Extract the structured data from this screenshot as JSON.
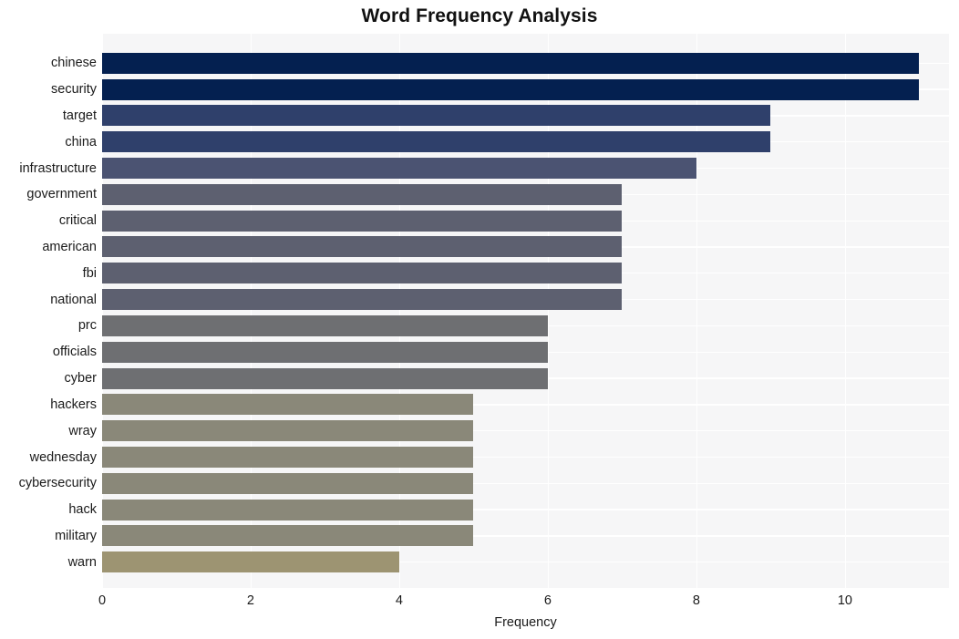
{
  "chart_data": {
    "type": "bar",
    "orientation": "horizontal",
    "title": "Word Frequency Analysis",
    "xlabel": "Frequency",
    "ylabel": "",
    "categories": [
      "chinese",
      "security",
      "target",
      "china",
      "infrastructure",
      "government",
      "critical",
      "american",
      "fbi",
      "national",
      "prc",
      "officials",
      "cyber",
      "hackers",
      "wray",
      "wednesday",
      "cybersecurity",
      "hack",
      "military",
      "warn"
    ],
    "values": [
      11,
      11,
      9,
      9,
      8,
      7,
      7,
      7,
      7,
      7,
      6,
      6,
      6,
      5,
      5,
      5,
      5,
      5,
      5,
      4
    ],
    "bar_colors": [
      "#042050",
      "#042050",
      "#2f406b",
      "#2f406b",
      "#4b5372",
      "#5d6070",
      "#5d6070",
      "#5d6070",
      "#5d6070",
      "#5d6070",
      "#6e6f72",
      "#6e6f72",
      "#6e6f72",
      "#8a8879",
      "#8a8879",
      "#8a8879",
      "#8a8879",
      "#8a8879",
      "#8a8879",
      "#9d9472"
    ],
    "xticks": [
      0,
      2,
      4,
      6,
      8,
      10
    ],
    "xlim": [
      0,
      11.4
    ],
    "grid": true,
    "legend": "none",
    "plot_background": "#f6f6f7",
    "grid_color": "#ffffff"
  }
}
